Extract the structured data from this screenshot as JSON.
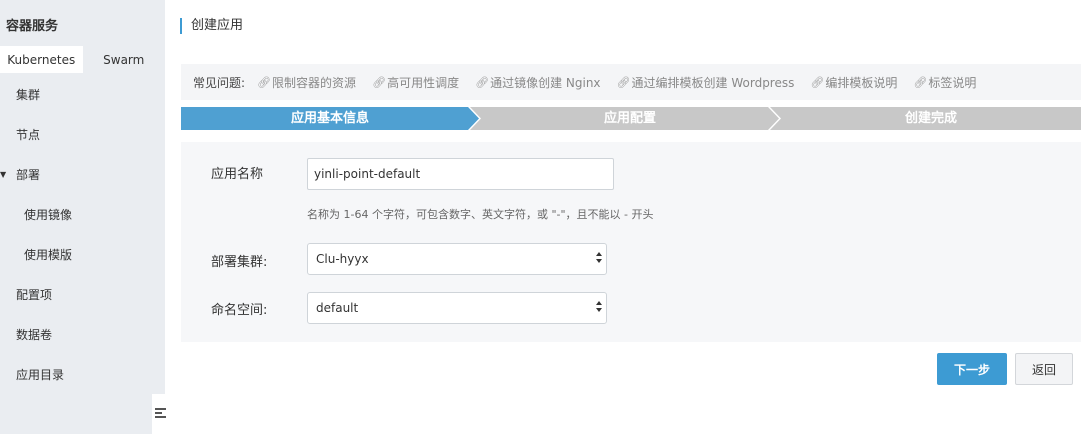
{
  "sidebar": {
    "title": "容器服务",
    "tabs": [
      {
        "label": "Kubernetes",
        "active": true
      },
      {
        "label": "Swarm",
        "active": false
      }
    ],
    "items": [
      {
        "label": "集群"
      },
      {
        "label": "节点"
      },
      {
        "label": "部署",
        "expanded": true
      },
      {
        "label": "使用镜像"
      },
      {
        "label": "使用模版"
      },
      {
        "label": "配置项"
      },
      {
        "label": "数据卷"
      },
      {
        "label": "应用目录"
      }
    ]
  },
  "header": {
    "title": "创建应用"
  },
  "faq": {
    "label": "常见问题:",
    "links": [
      "限制容器的资源",
      "高可用性调度",
      "通过镜像创建 Nginx",
      "通过编排模板创建 Wordpress",
      "编排模板说明",
      "标签说明"
    ]
  },
  "steps": [
    {
      "label": "应用基本信息",
      "active": true
    },
    {
      "label": "应用配置",
      "active": false
    },
    {
      "label": "创建完成",
      "active": false
    }
  ],
  "form": {
    "name_label": "应用名称",
    "name_value": "yinli-point-default",
    "name_hint": "名称为 1-64 个字符，可包含数字、英文字符，或 \"-\"，且不能以 - 开头",
    "cluster_label": "部署集群:",
    "cluster_value": "Clu-hyyx",
    "namespace_label": "命名空间:",
    "namespace_value": "default"
  },
  "buttons": {
    "next": "下一步",
    "back": "返回"
  },
  "colors": {
    "accent": "#3d9bd3",
    "step_active": "#4fa0d2",
    "step_inactive": "#c8c8c8",
    "sidebar_bg": "#eaedf1"
  }
}
